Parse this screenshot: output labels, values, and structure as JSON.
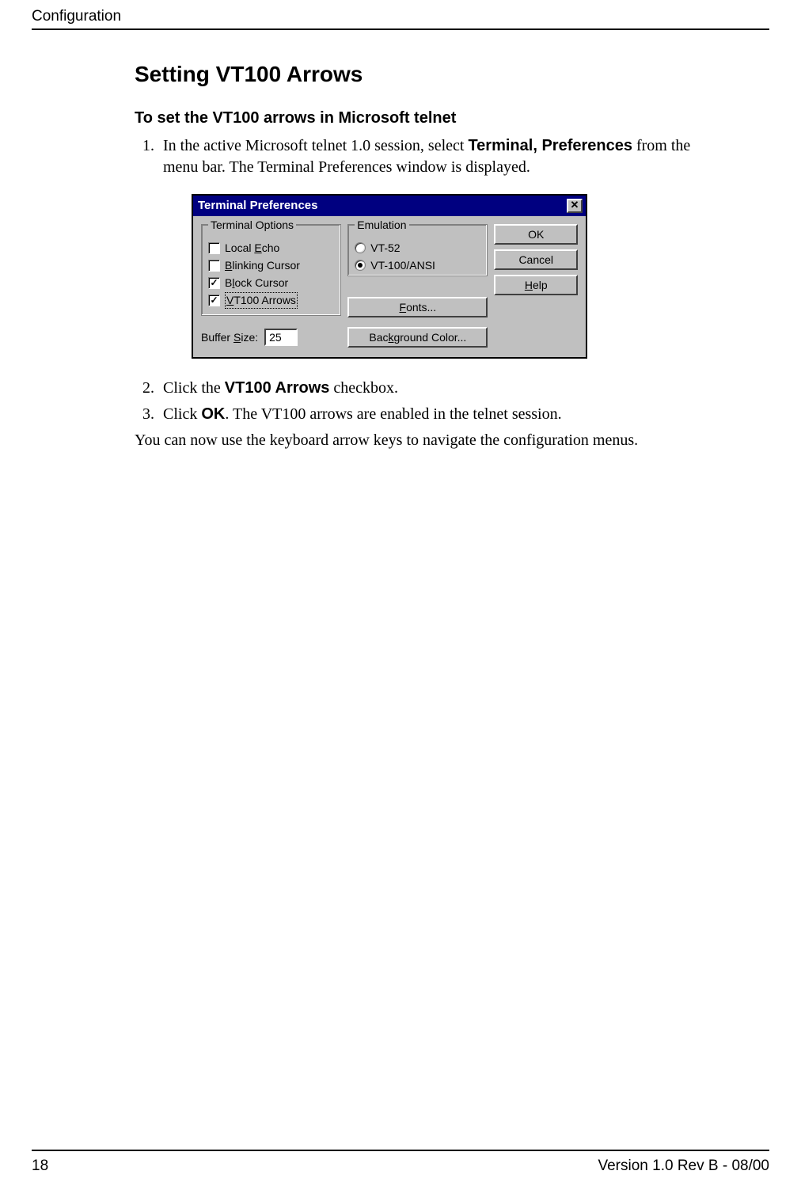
{
  "header": {
    "section": "Configuration"
  },
  "title": "Setting VT100 Arrows",
  "subtitle": "To set the VT100 arrows in Microsoft telnet",
  "steps": [
    {
      "pre": "In the active Microsoft telnet 1.0 session, select ",
      "bold": "Terminal, Preferences",
      "post": " from the menu bar. The Terminal Preferences window is displayed."
    },
    {
      "pre": "Click the ",
      "bold": "VT100 Arrows",
      "post": " checkbox."
    },
    {
      "pre": "Click ",
      "bold": "OK",
      "post": ". The VT100 arrows are enabled in the telnet session."
    }
  ],
  "closing_para": "You can now use the keyboard arrow keys to navigate the configuration menus.",
  "dialog": {
    "title": "Terminal Preferences",
    "close_glyph": "✕",
    "terminal_options": {
      "legend": "Terminal Options",
      "items": [
        {
          "label_pre": "Local ",
          "mn": "E",
          "label_post": "cho",
          "checked": false
        },
        {
          "label_pre": "",
          "mn": "B",
          "label_post": "linking Cursor",
          "checked": false
        },
        {
          "label_pre": "B",
          "mn": "l",
          "label_post": "ock Cursor",
          "checked": true
        },
        {
          "label_pre": "",
          "mn": "V",
          "label_post": "T100 Arrows",
          "checked": true,
          "focused": true
        }
      ]
    },
    "emulation": {
      "legend": "Emulation",
      "items": [
        {
          "label": "VT-52",
          "selected": false
        },
        {
          "label": "VT-100/ANSI",
          "selected": true
        }
      ]
    },
    "buttons": {
      "ok": "OK",
      "cancel": "Cancel",
      "help_mn": "H",
      "help_rest": "elp",
      "fonts_mn": "F",
      "fonts_rest": "onts...",
      "bgcolor_mn": "k",
      "bgcolor_pre": "Bac",
      "bgcolor_post": "ground Color..."
    },
    "buffer": {
      "label_pre": "Buffer ",
      "mn": "S",
      "label_post": "ize:",
      "value": "25"
    }
  },
  "footer": {
    "page": "18",
    "version": "Version 1.0 Rev B - 08/00"
  }
}
